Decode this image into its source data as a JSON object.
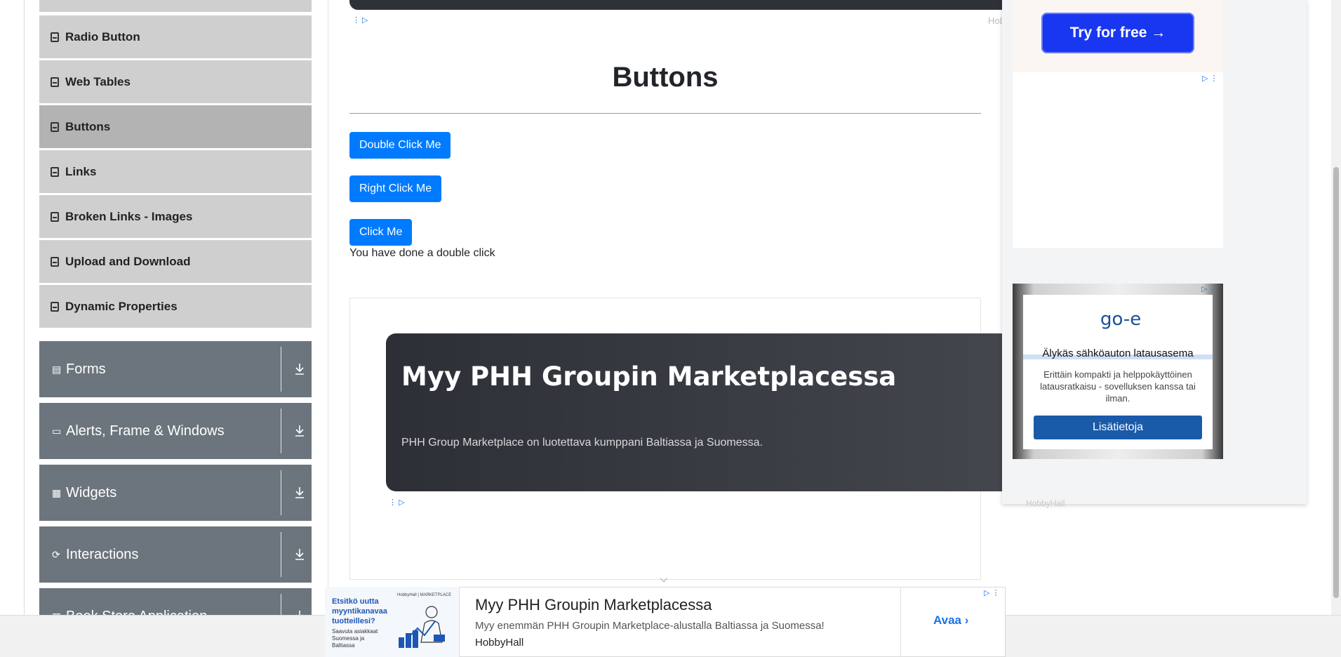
{
  "sidebar": {
    "elements_items": [
      {
        "label": "Radio Button",
        "active": false
      },
      {
        "label": "Web Tables",
        "active": false
      },
      {
        "label": "Buttons",
        "active": true
      },
      {
        "label": "Links",
        "active": false
      },
      {
        "label": "Broken Links - Images",
        "active": false
      },
      {
        "label": "Upload and Download",
        "active": false
      },
      {
        "label": "Dynamic Properties",
        "active": false
      }
    ],
    "groups": [
      {
        "label": "Forms",
        "icon": "form-icon"
      },
      {
        "label": "Alerts, Frame & Windows",
        "icon": "window-icon"
      },
      {
        "label": "Widgets",
        "icon": "widgets-icon"
      },
      {
        "label": "Interactions",
        "icon": "interactions-icon"
      },
      {
        "label": "Book Store Application",
        "icon": "book-store-icon"
      }
    ]
  },
  "main": {
    "title": "Buttons",
    "buttons": {
      "double_click": "Double Click Me",
      "right_click": "Right Click Me",
      "click": "Click Me"
    },
    "message": "You have done a double click"
  },
  "ads": {
    "top_hobby_label": "Hobb",
    "try_button": "Try for free →",
    "middle": {
      "headline": "Myy PHH Groupin Marketplacessa",
      "body": "PHH Group Marketplace on luotettava kumppani Baltiassa ja Suomessa."
    },
    "goe": {
      "logo": "go-e",
      "title": "Älykäs sähköauton latausasema",
      "description": "Erittäin kompakti ja helppokäyttöinen latausratkaisu - sovelluksen kanssa tai ilman.",
      "cta": "Lisätietoja"
    },
    "right_hobby_label": "HobbyHall",
    "bottom": {
      "image_headline": "Etsitkö uutta myyntikanavaa tuotteillesi?",
      "image_sub": "Saavuta asiakkaat Suomessa ja Baltiassa",
      "image_brand": "HobbyHall | MARKETPLACE",
      "title": "Myy PHH Groupin Marketplacessa",
      "subtitle": "Myy enemmän PHH Groupin Marketplace-alustalla Baltiassa ja Suomessa!",
      "brand": "HobbyHall",
      "cta": "Avaa"
    }
  },
  "colors": {
    "primary_button": "#007bff",
    "sidebar_item": "#cfcfcf",
    "sidebar_item_active": "#b3b3b3",
    "group_header": "#6c757d"
  }
}
